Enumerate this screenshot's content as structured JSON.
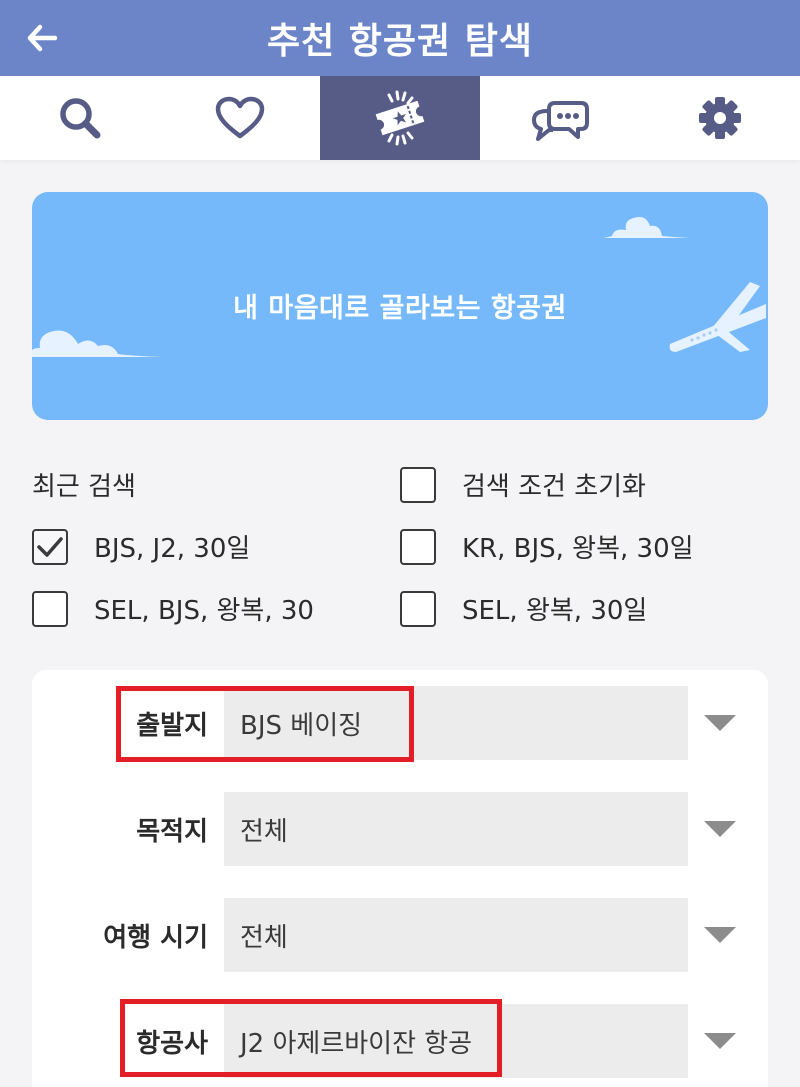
{
  "header": {
    "title": "추천 항공권 탐색",
    "back_icon": "arrow-left-icon"
  },
  "tabs": [
    {
      "icon": "search-icon",
      "active": false
    },
    {
      "icon": "heart-icon",
      "active": false
    },
    {
      "icon": "ticket-icon",
      "active": true
    },
    {
      "icon": "chat-icon",
      "active": false
    },
    {
      "icon": "gear-icon",
      "active": false
    }
  ],
  "banner": {
    "text": "내 마음대로 골라보는 항공권",
    "color": "#75b9fb"
  },
  "recent": {
    "label": "최근 검색",
    "reset_label": "검색 조건 초기화",
    "reset_checked": false,
    "items": [
      {
        "label": "BJS, J2, 30일",
        "checked": true
      },
      {
        "label": "KR, BJS, 왕복, 30일",
        "checked": false
      },
      {
        "label": "SEL, BJS, 왕복, 30",
        "checked": false
      },
      {
        "label": "SEL, 왕복, 30일",
        "checked": false
      }
    ]
  },
  "filters": {
    "departure": {
      "label": "출발지",
      "value": "BJS 베이징"
    },
    "destination": {
      "label": "목적지",
      "value": "전체"
    },
    "period": {
      "label": "여행 시기",
      "value": "전체"
    },
    "airline": {
      "label": "항공사",
      "value": "J2 아제르바이잔 항공"
    }
  },
  "colors": {
    "header": "#6c85c9",
    "active_tab": "#575c87",
    "highlight": "#e41e26"
  }
}
